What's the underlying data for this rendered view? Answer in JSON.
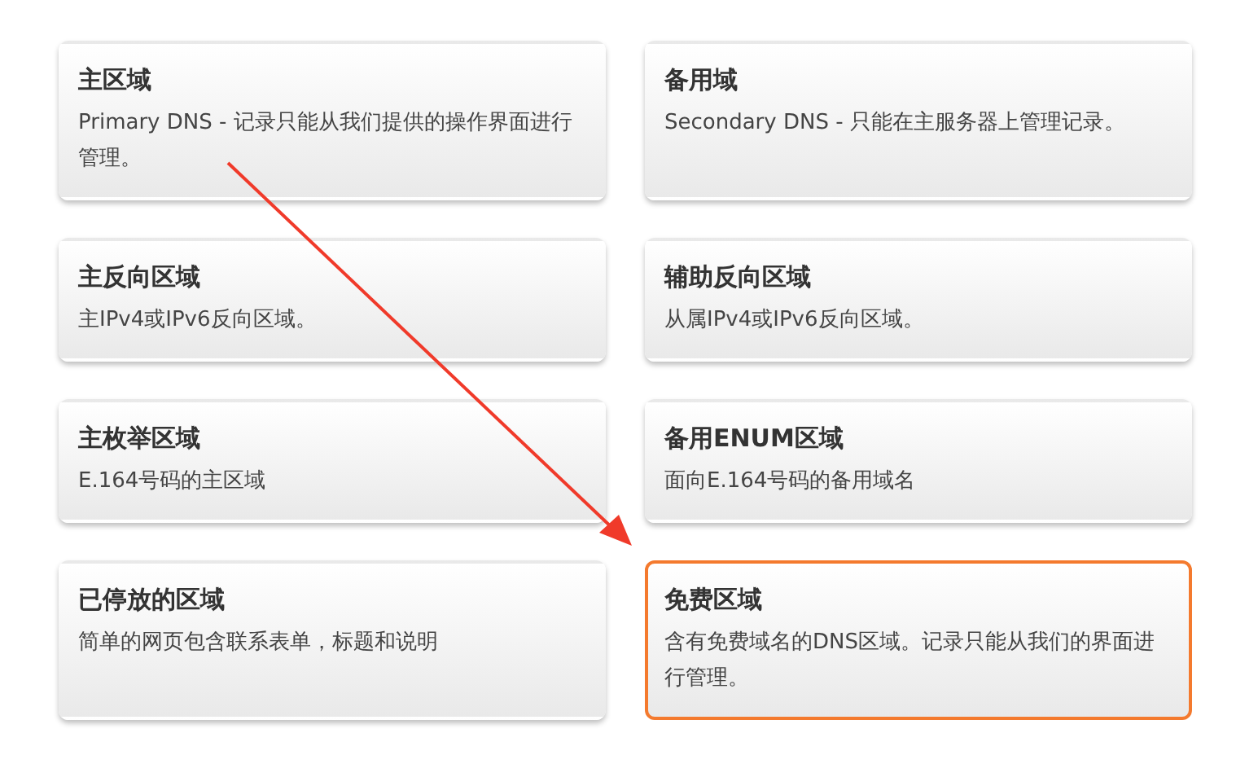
{
  "cards": [
    {
      "title": "主区域",
      "description": "Primary DNS - 记录只能从我们提供的操作界面进行管理。",
      "selected": false
    },
    {
      "title": "备用域",
      "description": "Secondary DNS - 只能在主服务器上管理记录。",
      "selected": false
    },
    {
      "title": "主反向区域",
      "description": "主IPv4或IPv6反向区域。",
      "selected": false
    },
    {
      "title": "辅助反向区域",
      "description": "从属IPv4或IPv6反向区域。",
      "selected": false
    },
    {
      "title": "主枚举区域",
      "description": "E.164号码的主区域",
      "selected": false
    },
    {
      "title": "备用ENUM区域",
      "description": "面向E.164号码的备用域名",
      "selected": false
    },
    {
      "title": "已停放的区域",
      "description": "简单的网页包含联系表单，标题和说明",
      "selected": false
    },
    {
      "title": "免费区域",
      "description": "含有免费域名的DNS区域。记录只能从我们的界面进行管理。",
      "selected": true
    }
  ]
}
